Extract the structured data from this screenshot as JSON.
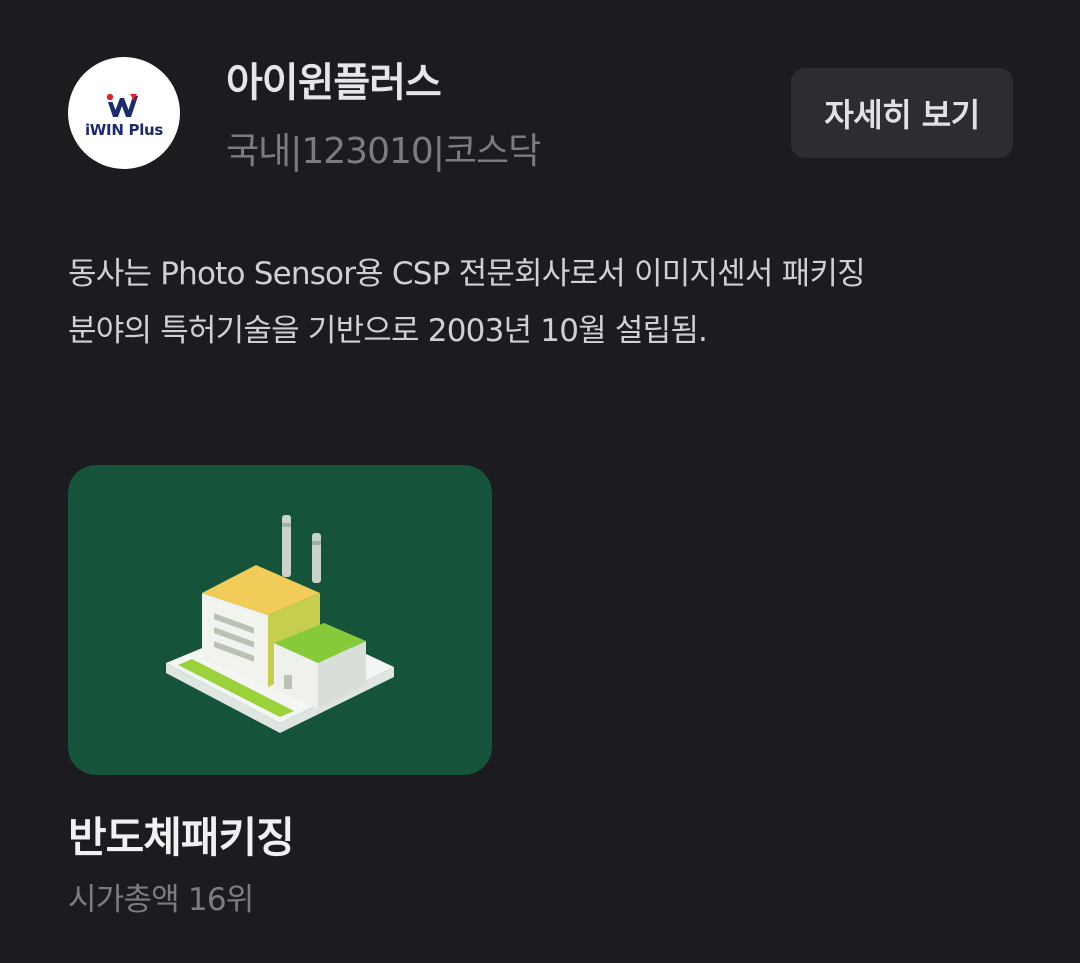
{
  "company": {
    "logo_text": "iWIN Plus",
    "name": "아이윈플러스",
    "meta": "국내|123010|코스닥"
  },
  "detail_button_label": "자세히 보기",
  "description": {
    "line1": "동사는 Photo Sensor용 CSP 전문회사로서 이미지센서 패키징",
    "line2": "분야의 특허기술을 기반으로 2003년 10월 설립됨."
  },
  "category": {
    "title": "반도체패키징",
    "rank": "시가총액 16위",
    "icon": "factory-icon"
  },
  "colors": {
    "background": "#1b1b20",
    "card_green": "#15543a",
    "button_bg": "#2c2c33",
    "muted_text": "#7b7b82"
  }
}
